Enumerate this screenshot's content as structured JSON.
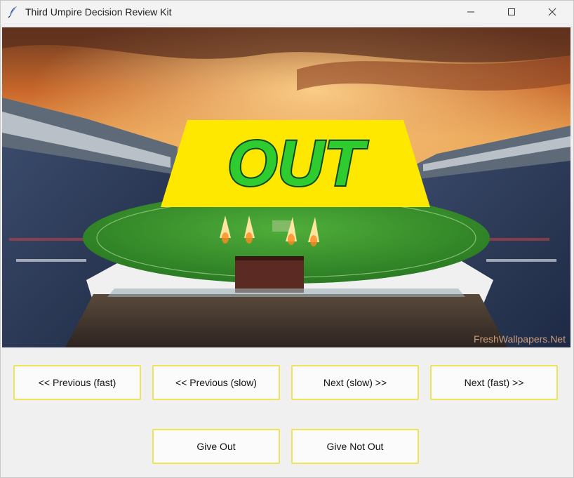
{
  "window": {
    "title": "Third Umpire Decision Review Kit",
    "controls": [
      "minimize",
      "maximize",
      "close"
    ]
  },
  "display": {
    "banner_text": "OUT",
    "watermark": "FreshWallpapers.Net",
    "banner_color": "#ffe800",
    "text_color": "#2ecc2e"
  },
  "buttons": {
    "prev_fast": "<< Previous (fast)",
    "prev_slow": "<< Previous (slow)",
    "next_slow": "Next (slow) >>",
    "next_fast": "Next (fast) >>",
    "give_out": "Give Out",
    "give_not_out": "Give Not Out"
  },
  "colors": {
    "button_border": "#efe35c",
    "window_bg": "#f0f0f0"
  }
}
